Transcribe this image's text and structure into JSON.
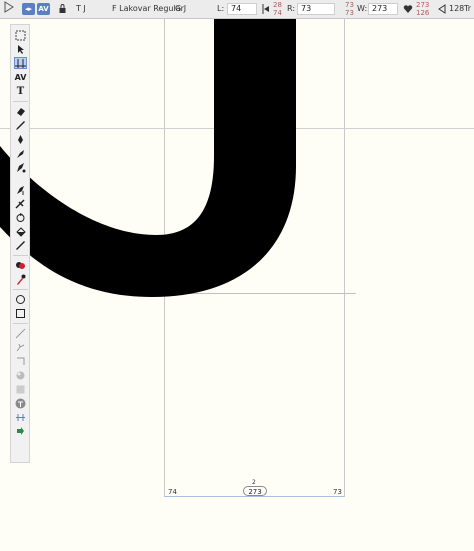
{
  "toolbar": {
    "text_tool_label": "T J",
    "font_label": "F Lakovar Regular",
    "glyph_label": "G J",
    "left_label": "L:",
    "left_value": "74",
    "left_stack": [
      "28",
      "74"
    ],
    "right_label": "R:",
    "right_value": "73",
    "right_stack": [
      "73",
      "73"
    ],
    "width_label": "W:",
    "width_value": "273",
    "width_stack": [
      "273",
      "126"
    ],
    "size_value": "128",
    "text_type_label": "Tr",
    "accent_color": "#5b7fc4"
  },
  "palette": {
    "tools": [
      "node-select-icon",
      "pointer-icon",
      "metrics-icon",
      "kerning-icon",
      "text-icon",
      "eraser-icon",
      "pencil-icon",
      "pen-icon",
      "bezier-pen-icon",
      "hobby-pen-icon",
      "add-point-icon",
      "knife-icon",
      "rotate-icon",
      "fill-icon",
      "measure-icon",
      "color-fill-icon",
      "eyedropper-icon",
      "ellipse-icon",
      "rectangle-icon",
      "line-icon",
      "corner-icon",
      "cut-icon",
      "sphere-icon",
      "texture-icon",
      "anchor-icon",
      "guides-icon",
      "cut-anchor-icon"
    ]
  },
  "canvas": {
    "left_sidebearing": "74",
    "advance_width": "273",
    "right_sidebearing": "73",
    "width_marker_above": "2"
  }
}
